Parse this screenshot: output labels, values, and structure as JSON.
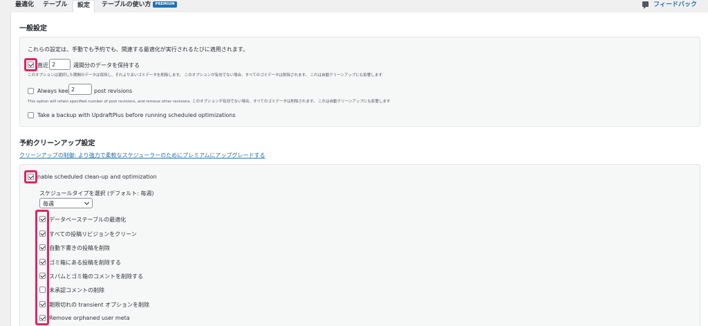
{
  "tabs": [
    {
      "label": "最適化"
    },
    {
      "label": "テーブル"
    },
    {
      "label": "設定"
    },
    {
      "label": "テーブルの使い方",
      "badge": "PREMIUM"
    }
  ],
  "feedback": {
    "label": "フィードバック",
    "icon": "comment-icon"
  },
  "general": {
    "title": "一般設定",
    "intro": "これらの設定は、手動でも予約でも、関連する最適化が実行されるたびに適用されます。",
    "retain_prefix": "直近",
    "retain_value": "2",
    "retain_suffix": "週間分のデータを保持する",
    "retain_note": "このオプションは選択した期間のデータは保持し、それより古いゴミデータを削除します。 このオプションが有効でない場合、すべてのゴミデータは削除されます。 これは自動クリーンアップにも影響します",
    "revisions_prefix": "Always keep",
    "revisions_value": "2",
    "revisions_suffix": "post revisions",
    "revisions_note": "This option will retain specified number of post revisions, and remove other revisions. このオプションが有効でない場合、すべてのゴミデータは削除されます。 これは自動クリーンアップにも影響します",
    "backup_label": "Take a backup with UpdraftPlus before running scheduled optimizations"
  },
  "scheduled": {
    "title": "予約クリーンアップ設定",
    "upgrade_link": "クリーンアップの制御: より強力で柔軟なスケジューラーのためにプレミアムにアップグレードする",
    "enable_label": "nable scheduled clean-up and optimization",
    "schedule_type_label": "スケジュールタイプを選択 (デフォルト: 毎週)",
    "schedule_value": "毎週",
    "options": [
      {
        "label": "データベーステーブルの最適化",
        "checked": true
      },
      {
        "label": "すべての投稿リビジョンをクリーン",
        "checked": true
      },
      {
        "label": "自動下書きの投稿を削除",
        "checked": true
      },
      {
        "label": "ゴミ箱にある投稿を削除する",
        "checked": true
      },
      {
        "label": "スパムとゴミ箱のコメントを削除する",
        "checked": true
      },
      {
        "label": "未承認コメントの削除",
        "checked": false
      },
      {
        "label": "期限切れの transient オプションを削除",
        "checked": true
      },
      {
        "label": "Remove orphaned user meta",
        "checked": true
      }
    ]
  },
  "colors": {
    "highlight": "#e0245e",
    "link": "#2271b1"
  }
}
